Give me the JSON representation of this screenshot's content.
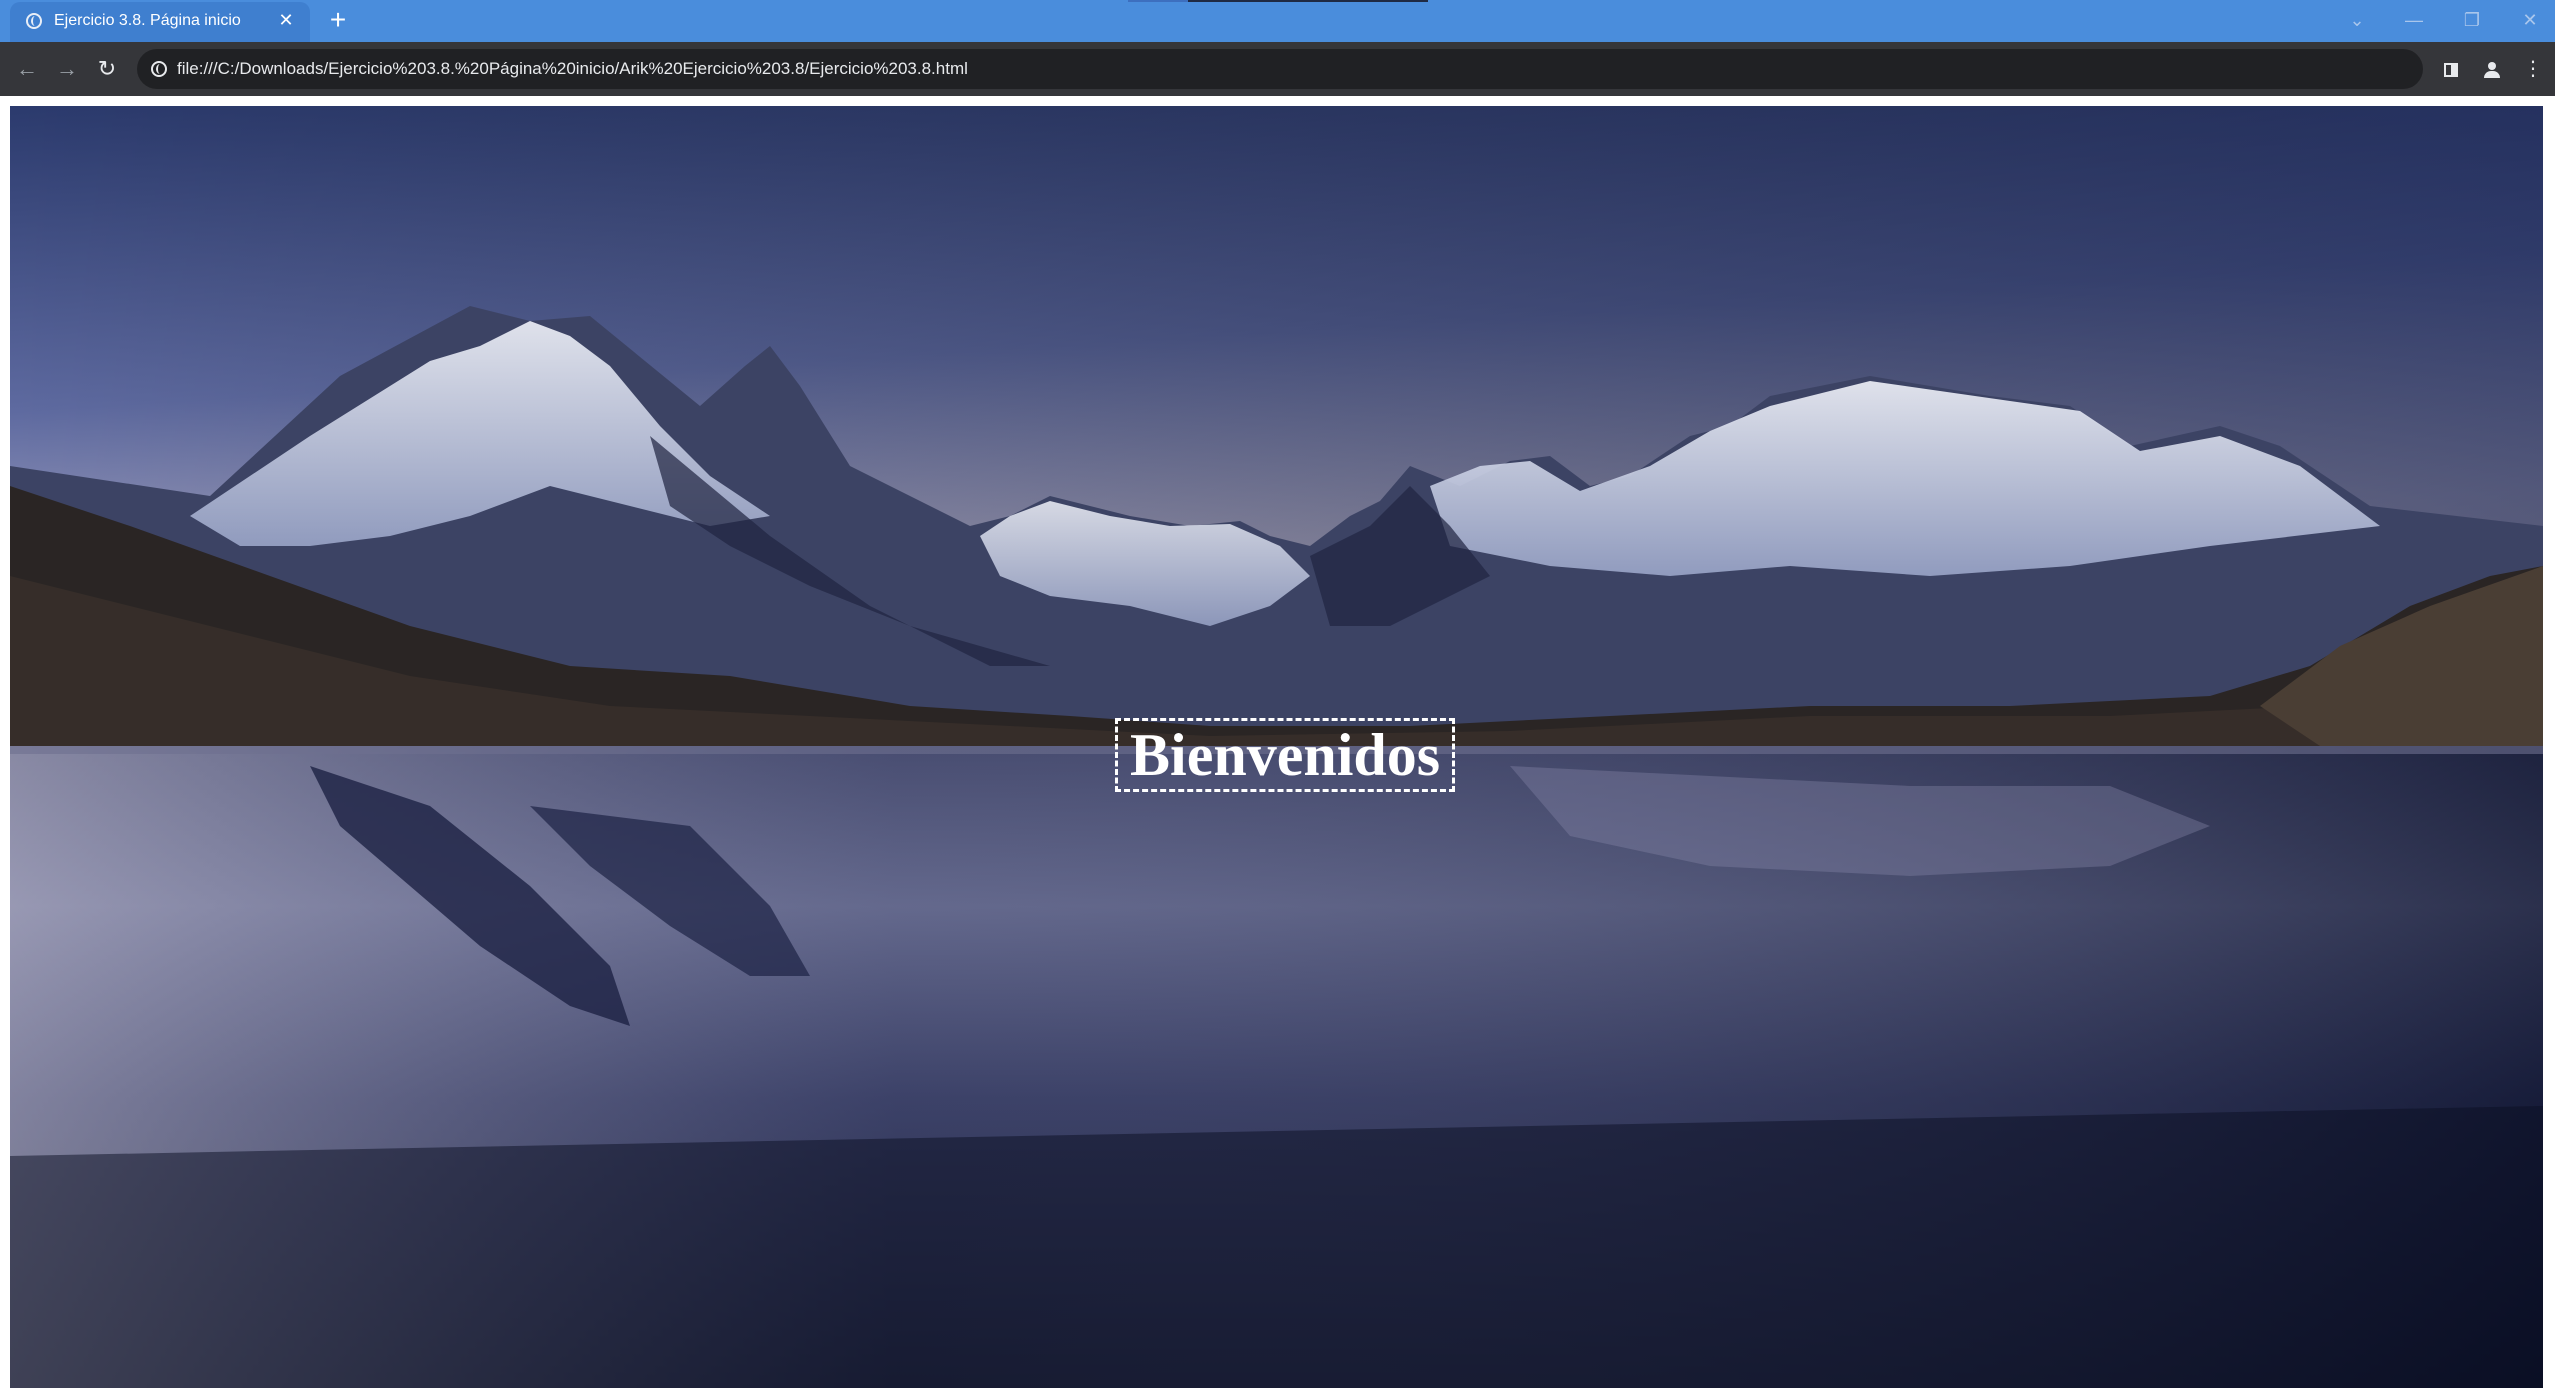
{
  "browser": {
    "tab": {
      "title": "Ejercicio 3.8. Página inicio",
      "close_glyph": "✕",
      "icon": "globe-icon"
    },
    "new_tab_glyph": "+",
    "window_controls": {
      "tab_search": "⌄",
      "minimize": "—",
      "restore": "❐",
      "close": "✕"
    },
    "toolbar": {
      "back_glyph": "←",
      "forward_glyph": "→",
      "reload_glyph": "↻",
      "url": "file:///C:/Downloads/Ejercicio%203.8.%20Página%20inicio/Arik%20Ejercicio%203.8/Ejercicio%203.8.html",
      "menu_glyph": "⋮",
      "site_info_icon": "globe-icon",
      "side_panel_icon": "side-panel-icon",
      "profile_icon": "profile-icon"
    }
  },
  "page": {
    "heading": "Bienvenidos",
    "heading_color": "#ffffff",
    "background": "mountain-lake-reflection-photo",
    "sky_colors": [
      "#2a3a6e",
      "#6f7aa8",
      "#c4bccc"
    ],
    "water_color": "#141a33"
  }
}
